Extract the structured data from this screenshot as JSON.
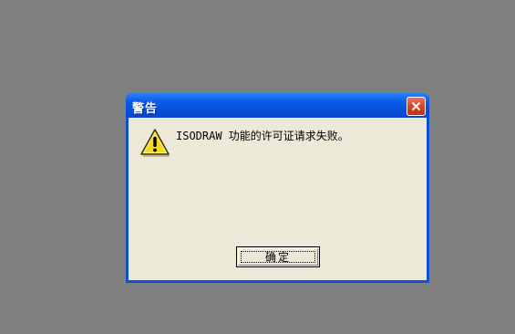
{
  "dialog": {
    "title": "警告",
    "message": "ISODRAW 功能的许可证请求失败。",
    "ok_label": "确定",
    "icon": "warning-icon",
    "close_icon": "close-icon"
  },
  "colors": {
    "desktop": "#808080",
    "titlebar": "#0550d8",
    "client": "#ece9d8",
    "close_button": "#d6452a",
    "warning_yellow": "#f8d820"
  }
}
